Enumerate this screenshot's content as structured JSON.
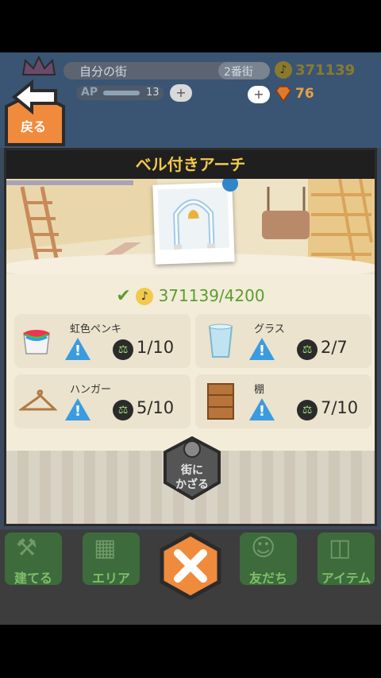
{
  "hud": {
    "town_name": "自分の街",
    "district": "2番街",
    "coins": "371139",
    "ap_label": "AP",
    "ap_value": "13",
    "gems": "76",
    "plus_symbol": "+"
  },
  "back_button": {
    "label": "戻る"
  },
  "panel": {
    "title": "ベル付きアーチ",
    "cost": "371139/4200",
    "materials": [
      {
        "name": "虹色ペンキ",
        "count": "1/10"
      },
      {
        "name": "グラス",
        "count": "2/7"
      },
      {
        "name": "ハンガー",
        "count": "5/10"
      },
      {
        "name": "棚",
        "count": "7/10"
      }
    ],
    "decorate_button": {
      "line1": "街に",
      "line2": "かざる"
    },
    "warning_glyph": "!"
  },
  "nav": {
    "items": [
      {
        "label": "建てる"
      },
      {
        "label": "エリア"
      },
      {
        "label": "友だち"
      },
      {
        "label": "アイテム"
      }
    ]
  },
  "colors": {
    "title_yellow": "#f2c94c",
    "cost_green": "#5a9d2e",
    "warning_blue": "#3b9be0",
    "close_orange": "#f08a3c"
  }
}
